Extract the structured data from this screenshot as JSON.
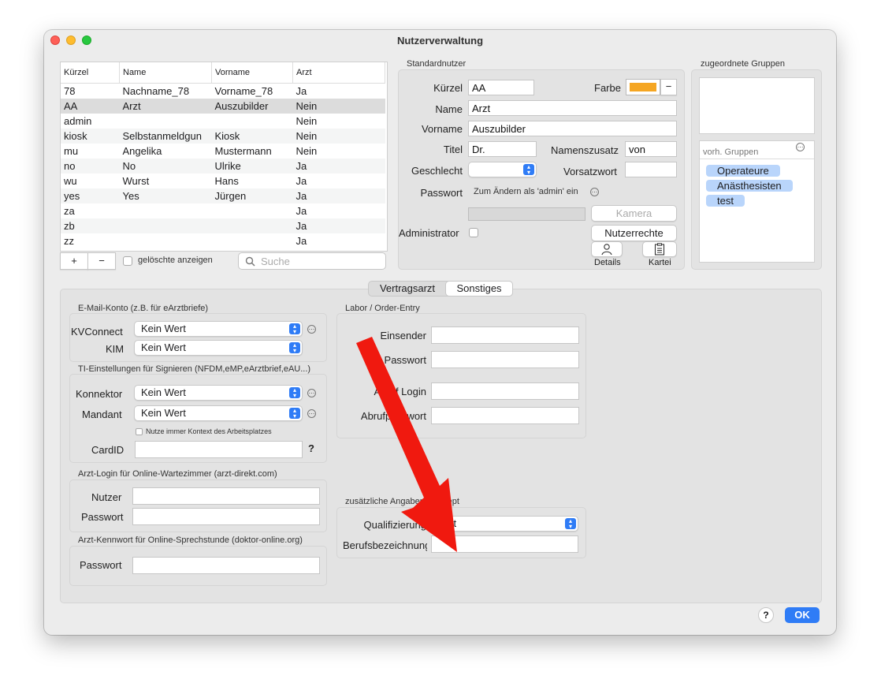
{
  "window": {
    "title": "Nutzerverwaltung"
  },
  "user_table": {
    "headers": [
      "Kürzel",
      "Name",
      "Vorname",
      "Arzt"
    ],
    "rows": [
      [
        "78",
        "Nachname_78",
        "Vorname_78",
        "Ja"
      ],
      [
        "AA",
        "Arzt",
        "Auszubilder",
        "Nein"
      ],
      [
        "admin",
        "",
        "",
        "Nein"
      ],
      [
        "kiosk",
        "Selbstanmeldgun",
        "Kiosk",
        "Nein"
      ],
      [
        "mu",
        "Angelika",
        "Mustermann",
        "Nein"
      ],
      [
        "no",
        "No",
        "Ulrike",
        "Ja"
      ],
      [
        "wu",
        "Wurst",
        "Hans",
        "Ja"
      ],
      [
        "yes",
        "Yes",
        "Jürgen",
        "Ja"
      ],
      [
        "za",
        "",
        "",
        "Ja"
      ],
      [
        "zb",
        "",
        "",
        "Ja"
      ],
      [
        "zz",
        "",
        "",
        "Ja"
      ]
    ],
    "selected_row": 1
  },
  "table_footer": {
    "add": "+",
    "remove": "−",
    "show_deleted": "gelöschte anzeigen",
    "search_placeholder": "Suche"
  },
  "standard_user": {
    "section_title": "Standardnutzer",
    "kuerzel_label": "Kürzel",
    "kuerzel_value": "AA",
    "farbe_label": "Farbe",
    "farbe_color": "#f5a623",
    "farbe_minus": "−",
    "name_label": "Name",
    "name_value": "Arzt",
    "vorname_label": "Vorname",
    "vorname_value": "Auszubilder",
    "titel_label": "Titel",
    "titel_value": "Dr.",
    "namenszusatz_label": "Namenszusatz",
    "namenszusatz_value": "von",
    "geschlecht_label": "Geschlecht",
    "vorsatzwort_label": "Vorsatzwort",
    "passwort_label": "Passwort",
    "passwort_hint": "Zum Ändern als 'admin' ein",
    "kamera_label": "Kamera",
    "administrator_label": "Administrator",
    "nutzerrechte_label": "Nutzerrechte",
    "details_label": "Details",
    "kartei_label": "Kartei"
  },
  "groups": {
    "section_title": "zugeordnete Gruppen",
    "available_title": "vorh. Gruppen",
    "items": [
      "Operateure",
      "Anästhesisten",
      "test"
    ]
  },
  "tabs": [
    "Vertragsarzt",
    "Sonstiges"
  ],
  "active_tab": 1,
  "email": {
    "section_title": "E-Mail-Konto (z.B. für eArztbriefe)",
    "kvconnect_label": "KVConnect",
    "kvconnect_value": "Kein Wert",
    "kim_label": "KIM",
    "kim_value": "Kein Wert"
  },
  "ti": {
    "section_title": "TI-Einstellungen für Signieren (NFDM,eMP,eArztbrief,eAU...)",
    "konnektor_label": "Konnektor",
    "konnektor_value": "Kein Wert",
    "mandant_label": "Mandant",
    "mandant_value": "Kein Wert",
    "context_checkbox": "Nutze immer Kontext des Arbeitsplatzes",
    "cardid_label": "CardID",
    "help": "?"
  },
  "arzt_login": {
    "section_title": "Arzt-Login für Online-Wartezimmer (arzt-direkt.com)",
    "nutzer_label": "Nutzer",
    "passwort_label": "Passwort"
  },
  "arzt_kennwort": {
    "section_title": "Arzt-Kennwort für Online-Sprechstunde (doktor-online.org)",
    "passwort_label": "Passwort"
  },
  "labor": {
    "section_title": "Labor / Order-Entry",
    "einsender_label": "Einsender",
    "passwort_label": "Passwort",
    "abruf_login_label": "Abruf Login",
    "abrufpasswort_label": "Abrufpasswort"
  },
  "erezept": {
    "section_title": "zusätzliche Angaben eRezept",
    "qualifizierung_label": "Qualifizierung",
    "qualifizierung_value": "Arzt",
    "berufsbezeichnung_label": "Berufsbezeichnung"
  },
  "footer": {
    "help": "?",
    "ok": "OK"
  },
  "colors": {
    "accent": "#2f7cf6",
    "arrow": "#f0190f",
    "selection": "#dcdcdc",
    "tag": "#b9d5fb"
  }
}
